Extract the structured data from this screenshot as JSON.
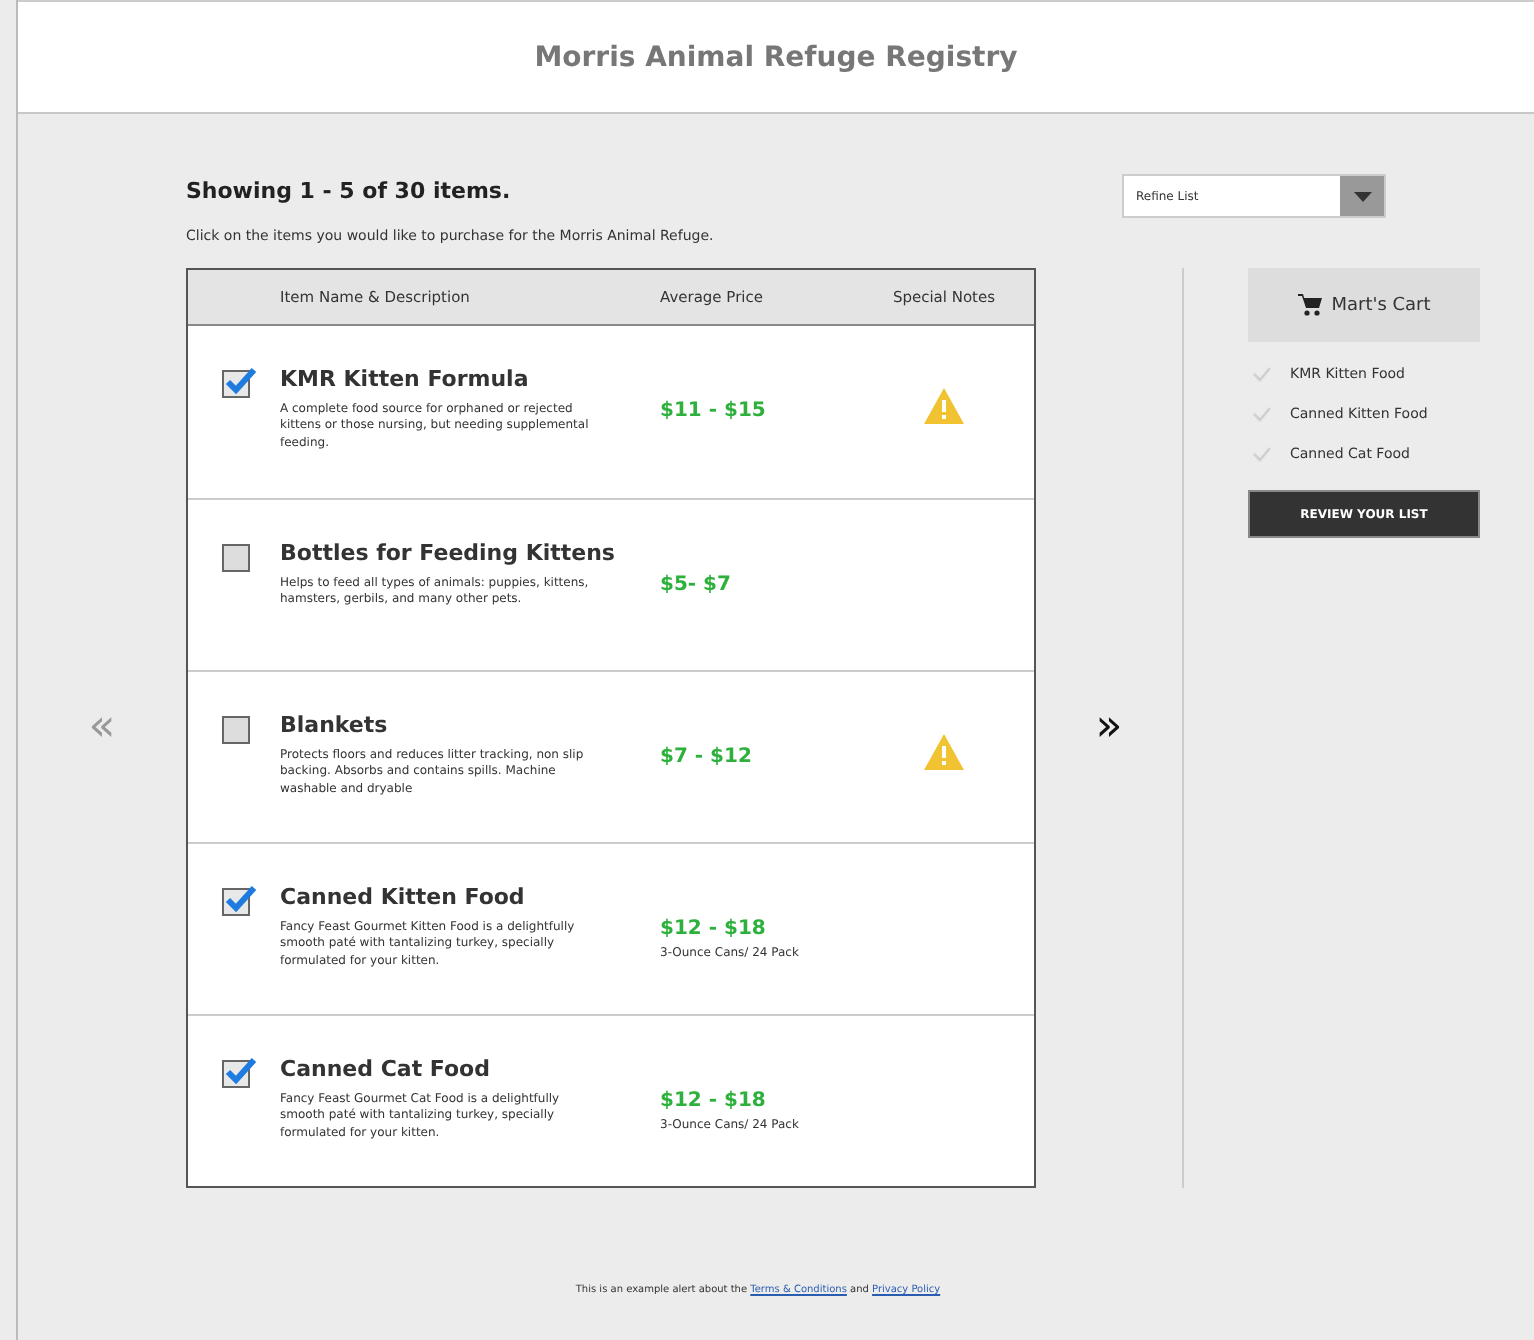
{
  "header": {
    "title": "Morris Animal Refuge Registry"
  },
  "summary": "Showing 1 - 5 of 30 items.",
  "instructions": "Click on the items you would like to purchase for the Morris Animal Refuge.",
  "refine": {
    "value": "Refine List"
  },
  "table": {
    "columns": [
      "Item Name & Description",
      "Average Price",
      "Special Notes"
    ],
    "rows": [
      {
        "checked": true,
        "name": "KMR Kitten Formula",
        "description": "A complete food source for orphaned or rejected kittens or those nursing, but needing supplemental feeding.",
        "price": "$11 - $15",
        "warning": true
      },
      {
        "checked": false,
        "name": "Bottles for Feeding Kittens",
        "description": "Helps to feed all types of animals: puppies, kittens, hamsters, gerbils, and many other pets.",
        "price": "$5- $7",
        "warning": false
      },
      {
        "checked": false,
        "name": "Blankets",
        "description": "Protects floors and reduces litter tracking, non slip backing. Absorbs and contains spills. Machine washable and dryable",
        "price": "$7 - $12",
        "warning": true
      },
      {
        "checked": true,
        "name": "Canned Kitten Food",
        "description": "Fancy Feast Gourmet Kitten Food is a delightfully smooth paté with tantalizing turkey, specially formulated for your kitten.",
        "price": "$12 - $18",
        "price_note": "3-Ounce Cans/ 24 Pack",
        "warning": false
      },
      {
        "checked": true,
        "name": "Canned Cat Food",
        "description": "Fancy Feast Gourmet Cat Food is a delightfully smooth paté with tantalizing turkey, specially formulated for your kitten.",
        "price": "$12 - $18",
        "price_note": "3-Ounce Cans/ 24 Pack",
        "warning": false
      }
    ]
  },
  "pager": {
    "previous": "«",
    "next": "»"
  },
  "cart": {
    "title": "Mart's Cart",
    "items": [
      "KMR Kitten Food",
      "Canned Kitten Food",
      "Canned Cat Food"
    ],
    "button": "REVIEW YOUR LIST"
  },
  "footer": {
    "before": "This is an example alert about the",
    "terms": "Terms & Conditions",
    "middle": "and",
    "privacy": "Privacy Policy"
  }
}
